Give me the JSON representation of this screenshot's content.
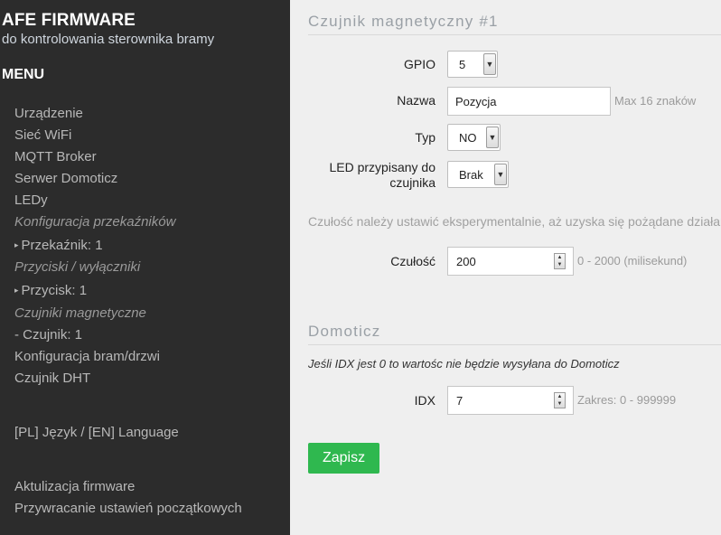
{
  "sidebar": {
    "brand": "AFE FIRMWARE",
    "subtitle": "do kontrolowania sterownika bramy",
    "menu_title": "MENU",
    "items": [
      "Urządzenie",
      "Sieć WiFi",
      "MQTT Broker",
      "Serwer Domoticz",
      "LEDy",
      "Konfiguracja przekaźników",
      "Przekaźnik: 1",
      "Przyciski / wyłączniki",
      "Przycisk: 1",
      "Czujniki magnetyczne",
      "- Czujnik: 1",
      "Konfiguracja bram/drzwi",
      "Czujnik DHT",
      "[PL] Język / [EN] Language",
      "Aktulizacja firmware",
      "Przywracanie ustawień początkowych"
    ]
  },
  "sensor": {
    "title": "Czujnik magnetyczny #1",
    "gpio_label": "GPIO",
    "gpio_value": "5",
    "name_label": "Nazwa",
    "name_value": "Pozycja",
    "name_hint": "Max 16 znaków",
    "type_label": "Typ",
    "type_value": "NO",
    "led_label_line1": "LED przypisany do",
    "led_label_line2": "czujnika",
    "led_value": "Brak",
    "sensitivity_info": "Czułość należy ustawić eksperymentalnie, aż uzyska się pożądane działanie",
    "sensitivity_label": "Czułość",
    "sensitivity_value": "200",
    "sensitivity_hint": "0 - 2000 (milisekund)"
  },
  "domoticz": {
    "title": "Domoticz",
    "info": "Jeśli IDX jest 0 to wartośc nie będzie wysyłana do Domoticz",
    "idx_label": "IDX",
    "idx_value": "7",
    "idx_hint": "Zakres: 0 - 999999"
  },
  "save_label": "Zapisz",
  "colors": {
    "sidebar_bg": "#2c2c2c",
    "main_bg": "#efefef",
    "save_button": "#2fb84f"
  }
}
